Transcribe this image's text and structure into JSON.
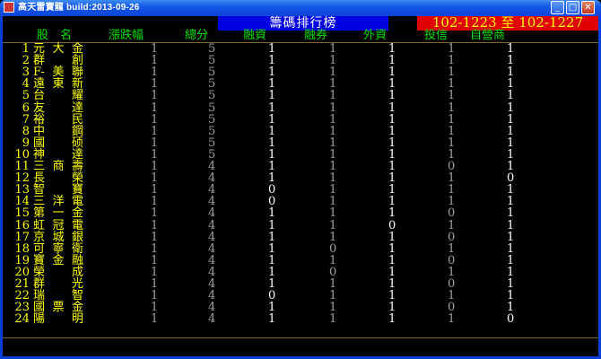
{
  "window": {
    "title": "高天雷寶龍 build:2013-09-26"
  },
  "header": {
    "title": "籌碼排行榜",
    "date_range": "102-1223 至 102-1227"
  },
  "columns": [
    "股　名",
    "漲跌幅",
    "總分",
    "融資",
    "融券",
    "外資",
    "投信",
    "自營商"
  ],
  "rows": [
    {
      "idx": "1",
      "name": "元大金",
      "chg": "1",
      "total": "5",
      "margin": "1",
      "short": "1",
      "foreign": "1",
      "trust": "1",
      "dealer": "1"
    },
    {
      "idx": "2",
      "name": "群創",
      "chg": "1",
      "total": "5",
      "margin": "1",
      "short": "1",
      "foreign": "1",
      "trust": "1",
      "dealer": "1"
    },
    {
      "idx": "3",
      "name": "F-美聯",
      "chg": "1",
      "total": "5",
      "margin": "1",
      "short": "1",
      "foreign": "1",
      "trust": "1",
      "dealer": "1"
    },
    {
      "idx": "4",
      "name": "遠東新",
      "chg": "1",
      "total": "5",
      "margin": "1",
      "short": "1",
      "foreign": "1",
      "trust": "1",
      "dealer": "1"
    },
    {
      "idx": "5",
      "name": "台耀",
      "chg": "1",
      "total": "5",
      "margin": "1",
      "short": "1",
      "foreign": "1",
      "trust": "1",
      "dealer": "1"
    },
    {
      "idx": "6",
      "name": "友達",
      "chg": "1",
      "total": "5",
      "margin": "1",
      "short": "1",
      "foreign": "1",
      "trust": "1",
      "dealer": "1"
    },
    {
      "idx": "7",
      "name": "裕民",
      "chg": "1",
      "total": "5",
      "margin": "1",
      "short": "1",
      "foreign": "1",
      "trust": "1",
      "dealer": "1"
    },
    {
      "idx": "8",
      "name": "中鋼",
      "chg": "1",
      "total": "5",
      "margin": "1",
      "short": "1",
      "foreign": "1",
      "trust": "1",
      "dealer": "1"
    },
    {
      "idx": "9",
      "name": "國硕",
      "chg": "1",
      "total": "5",
      "margin": "1",
      "short": "1",
      "foreign": "1",
      "trust": "1",
      "dealer": "1"
    },
    {
      "idx": "10",
      "name": "神達",
      "chg": "1",
      "total": "5",
      "margin": "1",
      "short": "1",
      "foreign": "1",
      "trust": "1",
      "dealer": "1"
    },
    {
      "idx": "11",
      "name": "三商壽",
      "chg": "1",
      "total": "4",
      "margin": "1",
      "short": "1",
      "foreign": "1",
      "trust": "0",
      "dealer": "1"
    },
    {
      "idx": "12",
      "name": "長榮",
      "chg": "1",
      "total": "4",
      "margin": "1",
      "short": "1",
      "foreign": "1",
      "trust": "1",
      "dealer": "0"
    },
    {
      "idx": "13",
      "name": "智寶",
      "chg": "1",
      "total": "4",
      "margin": "0",
      "short": "1",
      "foreign": "1",
      "trust": "1",
      "dealer": "1"
    },
    {
      "idx": "14",
      "name": "三洋電",
      "chg": "1",
      "total": "4",
      "margin": "0",
      "short": "1",
      "foreign": "1",
      "trust": "1",
      "dealer": "1"
    },
    {
      "idx": "15",
      "name": "第一金",
      "chg": "1",
      "total": "4",
      "margin": "1",
      "short": "1",
      "foreign": "1",
      "trust": "0",
      "dealer": "1"
    },
    {
      "idx": "16",
      "name": "虹冠電",
      "chg": "1",
      "total": "4",
      "margin": "1",
      "short": "1",
      "foreign": "0",
      "trust": "1",
      "dealer": "1"
    },
    {
      "idx": "17",
      "name": "京城銀",
      "chg": "1",
      "total": "4",
      "margin": "1",
      "short": "1",
      "foreign": "1",
      "trust": "0",
      "dealer": "1"
    },
    {
      "idx": "18",
      "name": "可寧衛",
      "chg": "1",
      "total": "4",
      "margin": "1",
      "short": "0",
      "foreign": "1",
      "trust": "1",
      "dealer": "1"
    },
    {
      "idx": "19",
      "name": "寶金融",
      "chg": "1",
      "total": "4",
      "margin": "1",
      "short": "1",
      "foreign": "1",
      "trust": "0",
      "dealer": "1"
    },
    {
      "idx": "20",
      "name": "榮成",
      "chg": "1",
      "total": "4",
      "margin": "1",
      "short": "0",
      "foreign": "1",
      "trust": "1",
      "dealer": "1"
    },
    {
      "idx": "21",
      "name": "群光",
      "chg": "1",
      "total": "4",
      "margin": "1",
      "short": "1",
      "foreign": "1",
      "trust": "0",
      "dealer": "1"
    },
    {
      "idx": "22",
      "name": "瑞智",
      "chg": "1",
      "total": "4",
      "margin": "0",
      "short": "1",
      "foreign": "1",
      "trust": "1",
      "dealer": "1"
    },
    {
      "idx": "23",
      "name": "國票金",
      "chg": "1",
      "total": "4",
      "margin": "1",
      "short": "1",
      "foreign": "1",
      "trust": "0",
      "dealer": "1"
    },
    {
      "idx": "24",
      "name": "陽明",
      "chg": "1",
      "total": "4",
      "margin": "1",
      "short": "1",
      "foreign": "1",
      "trust": "1",
      "dealer": "0"
    }
  ]
}
